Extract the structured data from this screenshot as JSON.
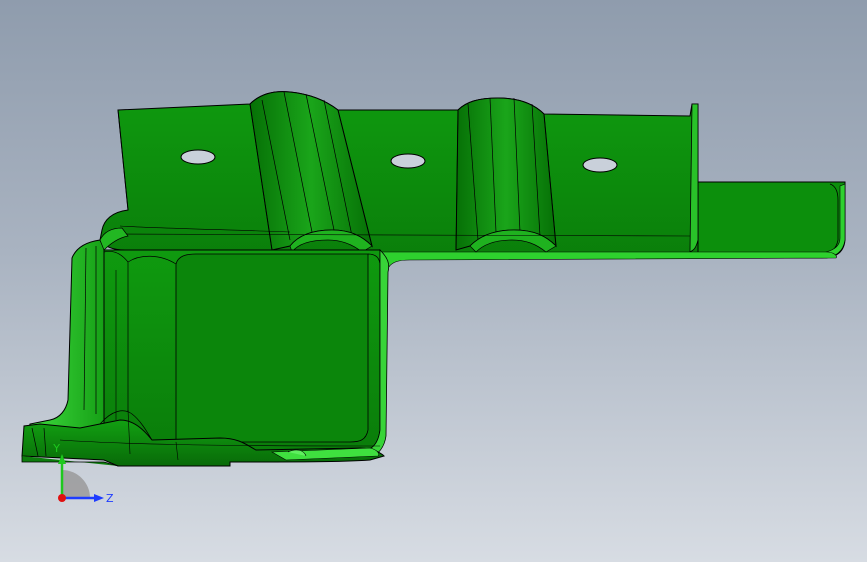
{
  "viewport": {
    "background_top": "#8f9cad",
    "background_bottom": "#d7dce3"
  },
  "model": {
    "part_color": "#0d8c0d",
    "part_light": "#1fb51f",
    "part_bright": "#47e047",
    "part_dark": "#075a07",
    "edge_color": "#000000",
    "hole_color": "#c9d0da"
  },
  "triad": {
    "y_label": "Y",
    "z_label": "Z",
    "y_color": "#1ec81e",
    "z_color": "#1e3cff",
    "x_color": "#e01010"
  }
}
